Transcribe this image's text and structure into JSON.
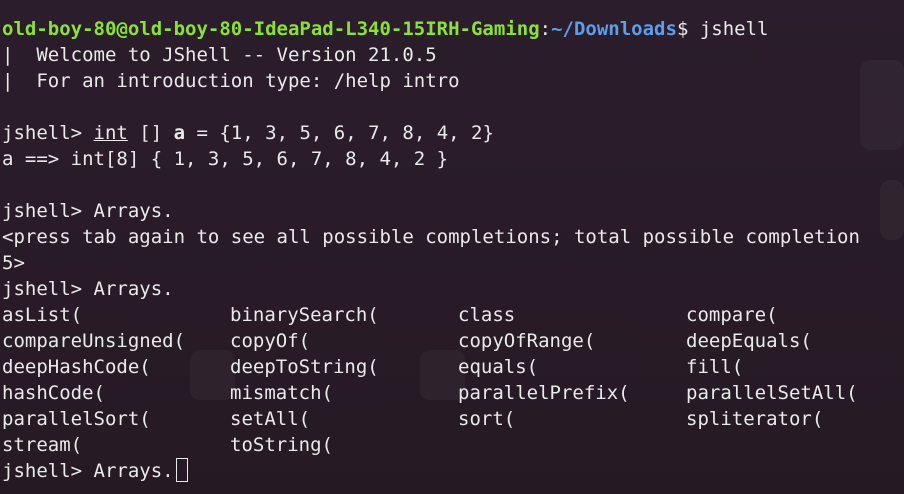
{
  "prompt": {
    "user_host": "old-boy-80@old-boy-80-IdeaPad-L340-15IRH-Gaming",
    "colon": ":",
    "path": "~/Downloads",
    "symbol": "$ ",
    "command": "jshell"
  },
  "welcome": [
    "|  Welcome to JShell -- Version 21.0.5",
    "|  For an introduction type: /help intro"
  ],
  "jshell_prompt": "jshell> ",
  "line1": {
    "kw": "int",
    "mid": " [] ",
    "var": "a",
    "rest": " = {1, 3, 5, 6, 7, 8, 4, 2}"
  },
  "line1_result": "a ==> int[8] { 1, 3, 5, 6, 7, 8, 4, 2 }",
  "line2_input": "Arrays.",
  "completion_hint": "<press tab again to see all possible completions; total possible completion",
  "completion_hint_wrap": "5>",
  "line3_input": "Arrays.",
  "completions": [
    [
      "asList(",
      "binarySearch(",
      "class",
      "compare("
    ],
    [
      "compareUnsigned(",
      "copyOf(",
      "copyOfRange(",
      "deepEquals("
    ],
    [
      "deepHashCode(",
      "deepToString(",
      "equals(",
      "fill("
    ],
    [
      "hashCode(",
      "mismatch(",
      "parallelPrefix(",
      "parallelSetAll("
    ],
    [
      "parallelSort(",
      "setAll(",
      "sort(",
      "spliterator("
    ],
    [
      "stream(",
      "toString(",
      "",
      ""
    ]
  ],
  "current_input": "Arrays."
}
